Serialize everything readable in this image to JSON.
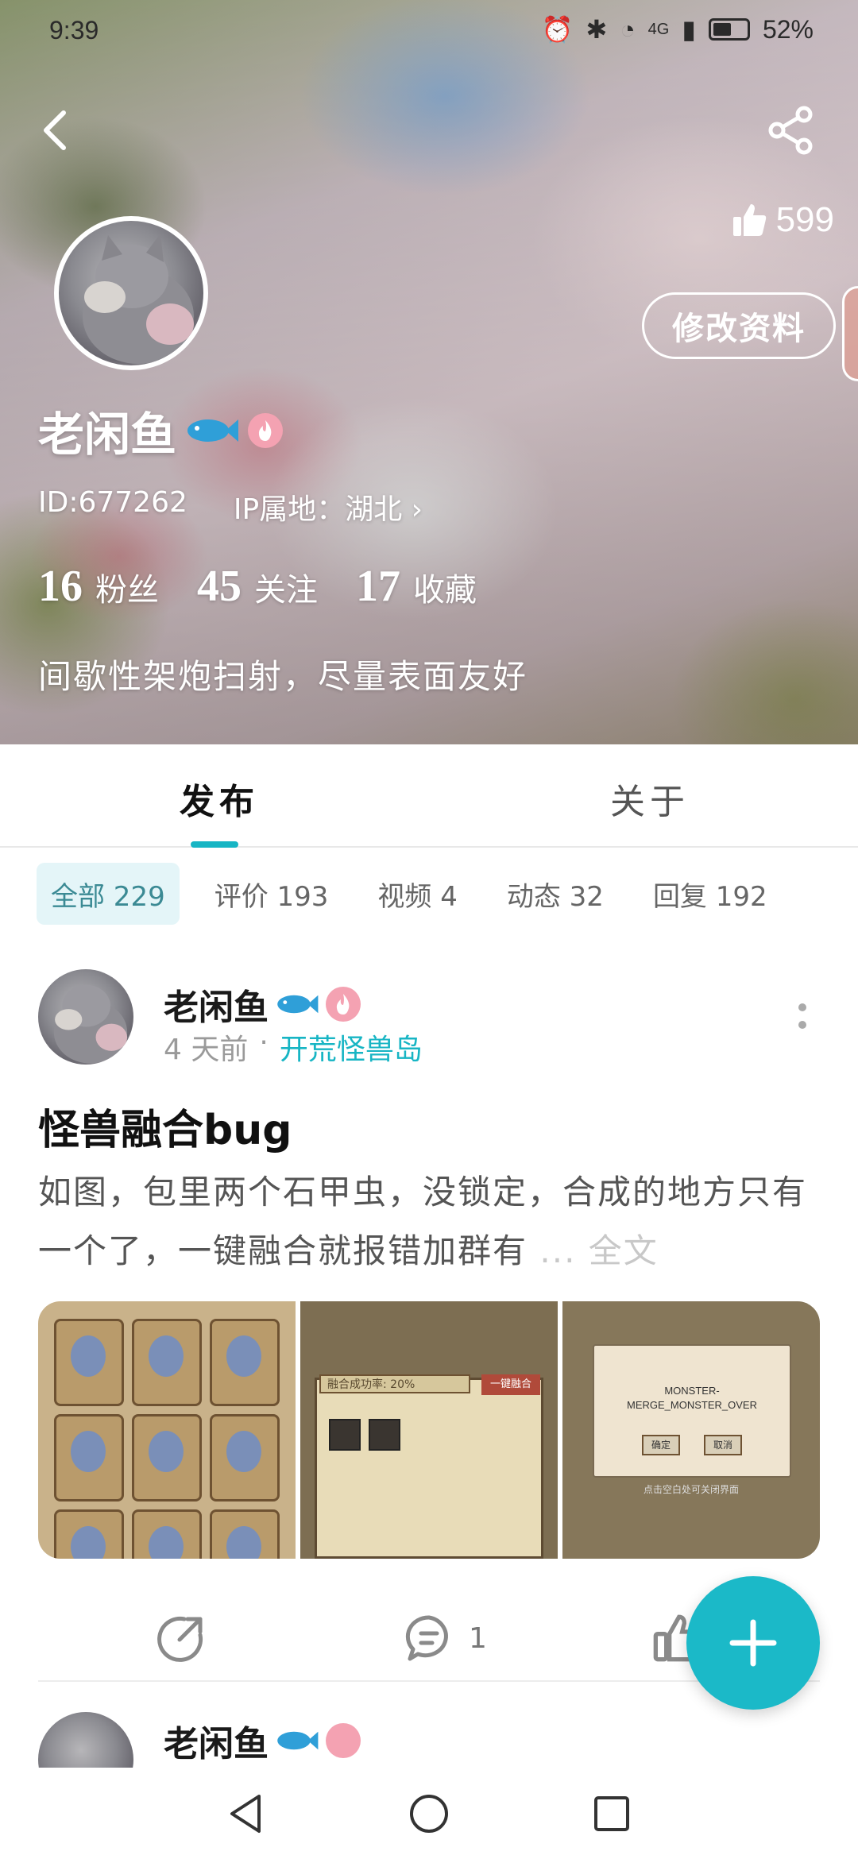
{
  "status_bar": {
    "time": "9:39",
    "network": "4G",
    "battery": "52%"
  },
  "profile": {
    "likes": "599",
    "edit_label": "修改资料",
    "username": "老闲鱼",
    "id": "ID:677262",
    "ip": "IP属地：湖北",
    "stats": [
      {
        "num": "16",
        "label": "粉丝"
      },
      {
        "num": "45",
        "label": "关注"
      },
      {
        "num": "17",
        "label": "收藏"
      }
    ],
    "bio": "间歇性架炮扫射，尽量表面友好"
  },
  "tabs": {
    "publish": "发布",
    "about": "关于"
  },
  "filters": [
    "全部 229",
    "评价 193",
    "视频 4",
    "动态 32",
    "回复 192"
  ],
  "post": {
    "author": "老闲鱼",
    "time": "4 天前",
    "separator": "·",
    "game": "开荒怪兽岛",
    "title": "怪兽融合bug",
    "body": "如图，包里两个石甲虫，没锁定，合成的地方只有一个了，一键融合就报错加群有",
    "more": "... 全文",
    "images": {
      "dialog_text": "MONSTER-\nMERGE_MONSTER_OVER",
      "confirm": "确定",
      "cancel": "取消",
      "hint": "点击空白处可关闭界面",
      "merge_label": "融合成功率: 20%",
      "merge_button": "一键融合"
    },
    "comments": "1"
  },
  "post2": {
    "author": "老闲鱼"
  },
  "colors": {
    "accent": "#1bb9c8",
    "fire_badge": "#f4a2b2"
  },
  "icons": [
    "back-icon",
    "share-icon",
    "thumb-up-icon",
    "fish-icon",
    "fire-icon",
    "more-vert-icon",
    "share-arrow-icon",
    "comment-icon",
    "plus-icon",
    "nav-back-icon",
    "nav-home-icon",
    "nav-recent-icon"
  ]
}
